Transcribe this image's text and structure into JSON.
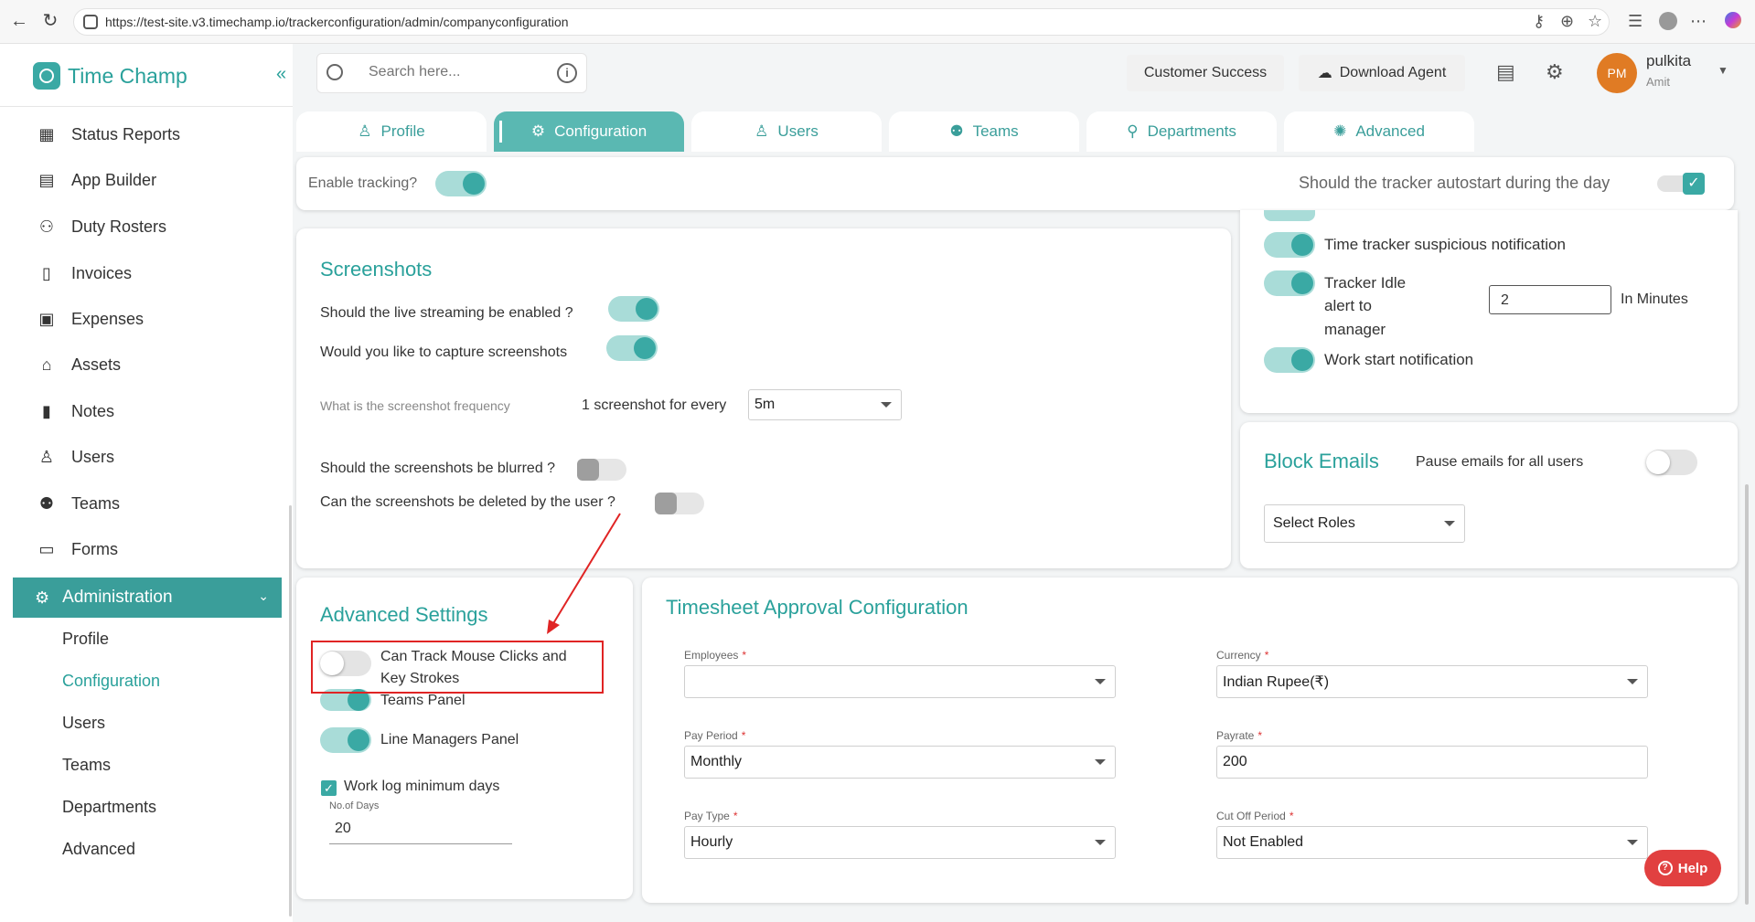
{
  "browser": {
    "url": "https://test-site.v3.timechamp.io/trackerconfiguration/admin/companyconfiguration"
  },
  "app": {
    "name": "Time Champ"
  },
  "sidebar": {
    "items": [
      {
        "label": "Status Reports",
        "icon": "grid-icon"
      },
      {
        "label": "App Builder",
        "icon": "app-builder-icon"
      },
      {
        "label": "Duty Rosters",
        "icon": "user-plus-icon"
      },
      {
        "label": "Invoices",
        "icon": "invoice-icon"
      },
      {
        "label": "Expenses",
        "icon": "wallet-icon"
      },
      {
        "label": "Assets",
        "icon": "bank-icon"
      },
      {
        "label": "Notes",
        "icon": "notebook-icon"
      },
      {
        "label": "Users",
        "icon": "user-icon"
      },
      {
        "label": "Teams",
        "icon": "team-icon"
      },
      {
        "label": "Forms",
        "icon": "document-icon"
      }
    ],
    "admin": {
      "label": "Administration",
      "sub_items": [
        "Profile",
        "Configuration",
        "Users",
        "Teams",
        "Departments",
        "Advanced"
      ],
      "active_sub": "Configuration"
    }
  },
  "header": {
    "search_placeholder": "Search here...",
    "customer_success": "Customer Success",
    "download_agent": "Download Agent",
    "avatar_initials": "PM",
    "user_name": "pulkita",
    "user_sub": "Amit"
  },
  "tabs": [
    "Profile",
    "Configuration",
    "Users",
    "Teams",
    "Departments",
    "Advanced"
  ],
  "tracking": {
    "enable_label": "Enable tracking?",
    "autostart_label": "Should the tracker autostart during the day"
  },
  "screenshots": {
    "title": "Screenshots",
    "live_streaming": "Should the live streaming be enabled ?",
    "capture": "Would you like to capture screenshots",
    "frequency_label": "What is the screenshot frequency",
    "frequency_prefix": "1 screenshot for every",
    "frequency_value": "5m",
    "blurred": "Should the screenshots be blurred ?",
    "deleted": "Can the screenshots be deleted by the user ?"
  },
  "notifications": {
    "suspicious": "Time tracker suspicious notification",
    "idle_line1": "Tracker Idle",
    "idle_line2": "alert to",
    "idle_line3": "manager",
    "idle_value": "2",
    "idle_unit": "In Minutes",
    "work_start": "Work start notification"
  },
  "block_emails": {
    "title": "Block Emails",
    "pause_label": "Pause emails for all users",
    "select_roles": "Select Roles"
  },
  "advanced_settings": {
    "title": "Advanced Settings",
    "mouse_line1": "Can Track Mouse Clicks and",
    "mouse_line2": "Key Strokes",
    "teams_panel": "Teams Panel",
    "line_managers_panel": "Line Managers Panel",
    "work_log": "Work log minimum days",
    "days_label": "No.of Days",
    "days_value": "20"
  },
  "timesheet": {
    "title": "Timesheet Approval Configuration",
    "employees_label": "Employees",
    "employees_value": "",
    "currency_label": "Currency",
    "currency_value": "Indian Rupee(₹)",
    "pay_period_label": "Pay Period",
    "pay_period_value": "Monthly",
    "payrate_label": "Payrate",
    "payrate_value": "200",
    "pay_type_label": "Pay Type",
    "pay_type_value": "Hourly",
    "cutoff_label": "Cut Off Period",
    "cutoff_value": "Not Enabled"
  },
  "help": {
    "label": "Help"
  },
  "colors": {
    "accent": "#3aa9a4",
    "accent_light": "#a9dcd8",
    "annotation": "#e02424",
    "help": "#e14040",
    "avatar": "#e07b24"
  }
}
